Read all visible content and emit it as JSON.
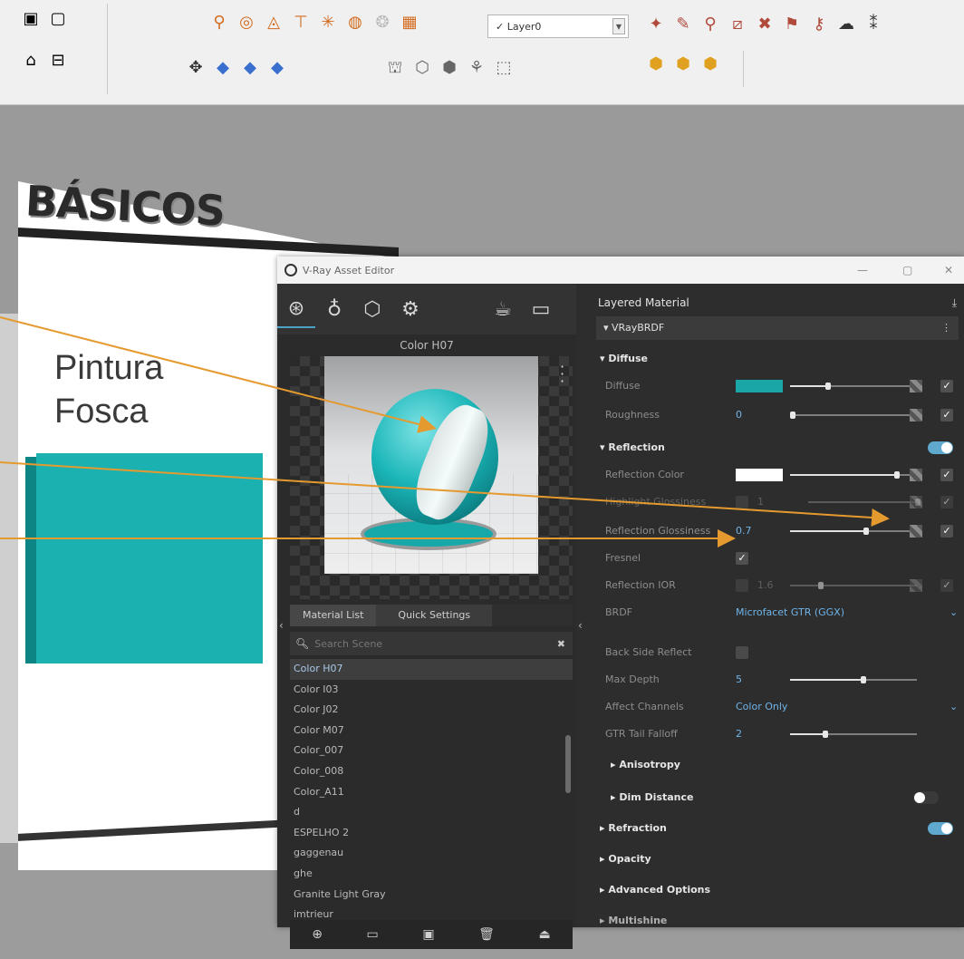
{
  "toolbar": {
    "layer_select": "✓ Layer0",
    "icons_row1": [
      "⚲",
      "◎",
      "◬",
      "⊤",
      "✳",
      "◍",
      "❂",
      "▦"
    ],
    "icons_row2": [
      "✥",
      "◆",
      "◆",
      "◆"
    ],
    "icons_row3": [
      "⛫",
      "⬡",
      "⬢",
      "⚘",
      "⬚"
    ],
    "icons_right1": [
      "✦",
      "✎",
      "⚲",
      "⧄",
      "✖",
      "⚑",
      "⚷",
      "☁",
      "⁑"
    ],
    "icons_right2": [
      "⬢",
      "⬢",
      "⬢"
    ],
    "icons_left": [
      "▣",
      "▢",
      "⌂",
      "⊟"
    ]
  },
  "scene": {
    "sign_text": "BÁSICOS",
    "label_line1": "Pintura",
    "label_line2": "Fosca"
  },
  "editor": {
    "title": "V-Ray Asset Editor",
    "win_min": "—",
    "win_max": "▢",
    "win_close": "✕",
    "preview_title": "Color H07",
    "tabs": [
      "Material List",
      "Quick Settings"
    ],
    "search_placeholder": "Search Scene",
    "materials": [
      "Color H07",
      "Color I03",
      "Color J02",
      "Color M07",
      "Color_007",
      "Color_008",
      "Color_A11",
      "d",
      "ESPELHO 2",
      "gaggenau",
      "ghe",
      "Granite Light Gray",
      "imtrieur"
    ],
    "right": {
      "header": "Layered Material",
      "brdf": "VRayBRDF",
      "diffuse_section": "Diffuse",
      "diffuse_label": "Diffuse",
      "diffuse_color": "#1aa5a7",
      "roughness_label": "Roughness",
      "roughness_value": "0",
      "reflection_section": "Reflection",
      "reflection_color_label": "Reflection Color",
      "highlight_glossiness_label": "Highlight Glossiness",
      "highlight_glossiness_value": "1",
      "reflection_glossiness_label": "Reflection Glossiness",
      "reflection_glossiness_value": "0.7",
      "fresnel_label": "Fresnel",
      "ior_label": "Reflection IOR",
      "ior_value": "1.6",
      "brdf_label": "BRDF",
      "brdf_value": "Microfacet GTR (GGX)",
      "back_side_label": "Back Side Reflect",
      "max_depth_label": "Max Depth",
      "max_depth_value": "5",
      "affect_channels_label": "Affect Channels",
      "affect_channels_value": "Color Only",
      "gtr_label": "GTR Tail Falloff",
      "gtr_value": "2",
      "anisotropy": "Anisotropy",
      "dim_distance": "Dim Distance",
      "refraction": "Refraction",
      "opacity": "Opacity",
      "advanced": "Advanced Options",
      "multishine": "Multishine"
    }
  },
  "colors": {
    "accent": "#4aa3c7",
    "teal": "#1bb1b1",
    "arrow": "#e59a2f"
  }
}
